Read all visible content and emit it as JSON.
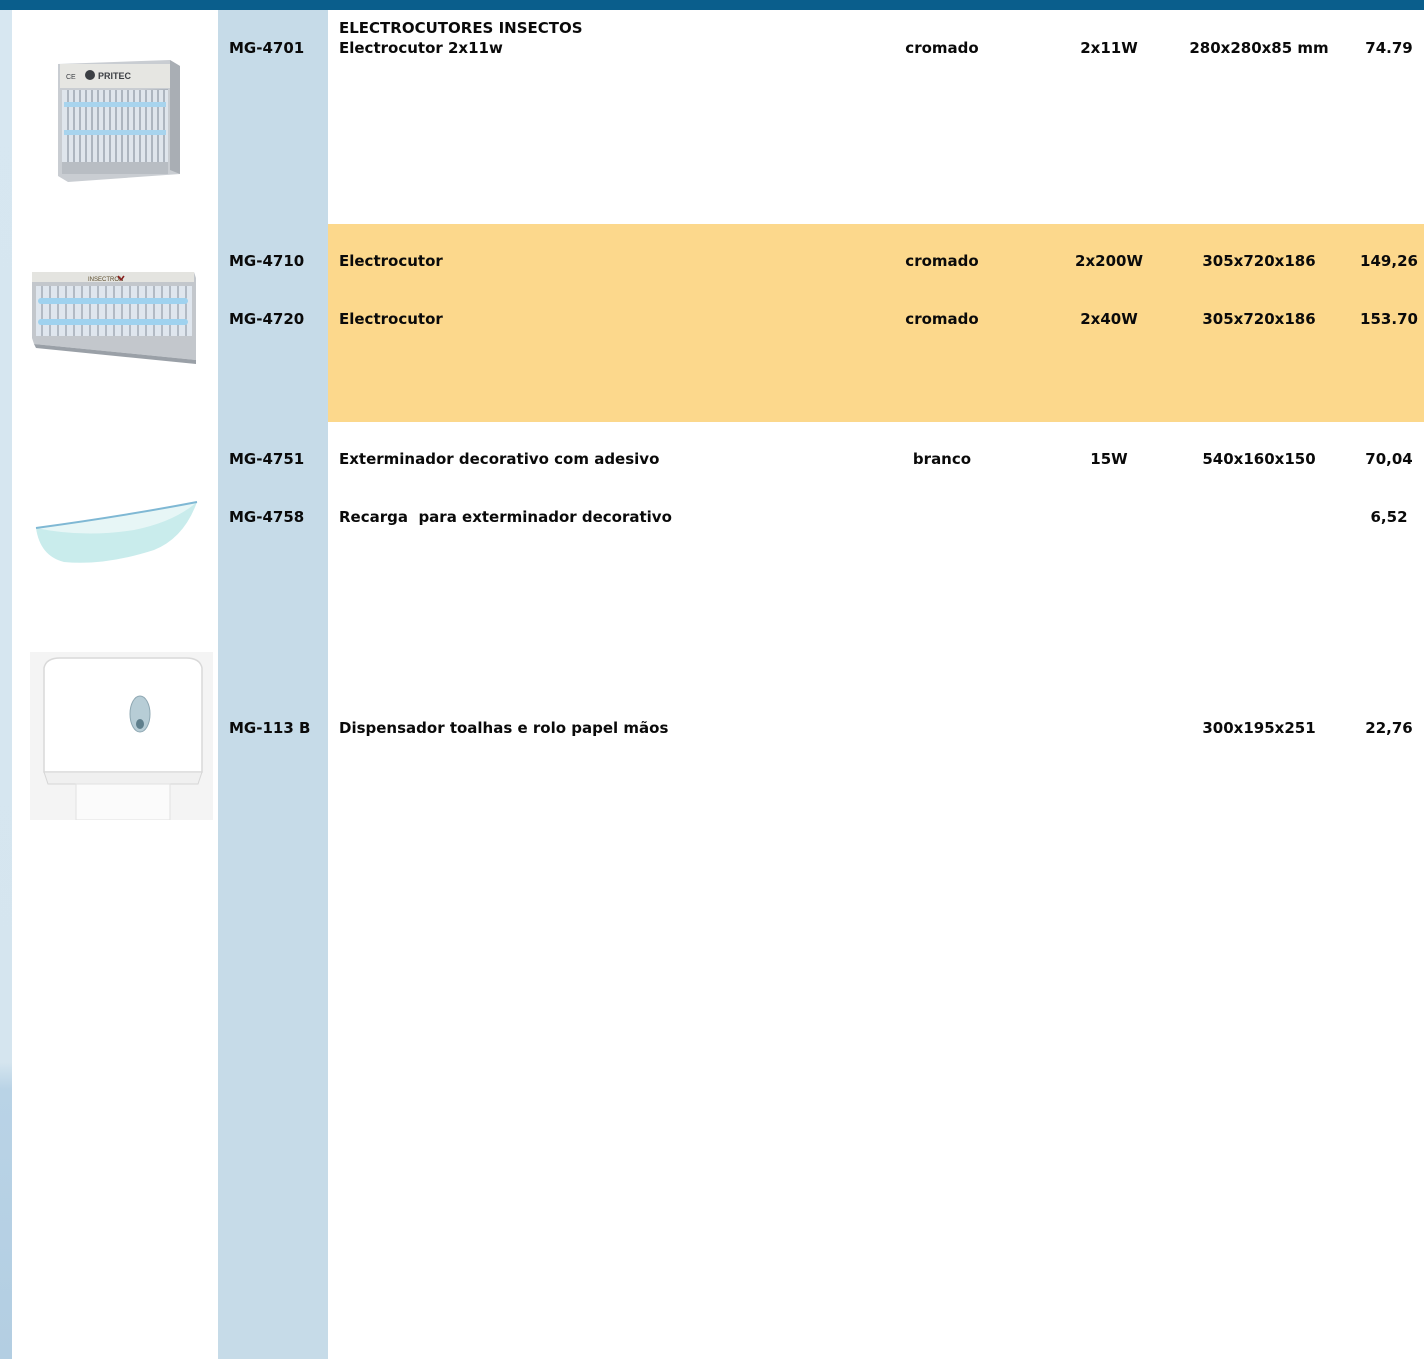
{
  "section_title": "ELECTROCUTORES INSECTOS",
  "rows": [
    {
      "code": "MG-4701",
      "description": "Electrocutor 2x11w",
      "finish": "cromado",
      "power": "2x11W",
      "dimensions": "280x280x85 mm",
      "price": "74.79"
    },
    {
      "code": "MG-4710",
      "description": "Electrocutor",
      "finish": "cromado",
      "power": "2x200W",
      "dimensions": "305x720x186",
      "price": "149,26"
    },
    {
      "code": "MG-4720",
      "description": "Electrocutor",
      "finish": "cromado",
      "power": "2x40W",
      "dimensions": "305x720x186",
      "price": "153.70"
    },
    {
      "code": "MG-4751",
      "description": "Exterminador decorativo com adesivo",
      "finish": "branco",
      "power": "15W",
      "dimensions": "540x160x150",
      "price": "70,04"
    },
    {
      "code": "MG-4758",
      "description": "Recarga  para exterminador decorativo",
      "finish": "",
      "power": "",
      "dimensions": "",
      "price": "6,52"
    },
    {
      "code": "MG-113 B",
      "description": "Dispensador toalhas e rolo papel mãos",
      "finish": "",
      "power": "",
      "dimensions": "300x195x251",
      "price": "22,76"
    }
  ],
  "images": {
    "square_zapper": {
      "icon": "square-insect-zapper",
      "brand_logo": "PRITEC"
    },
    "long_zapper": {
      "icon": "long-insect-zapper"
    },
    "decorative_trap": {
      "icon": "decorative-insect-trap"
    },
    "towel_dispenser": {
      "icon": "towel-dispenser"
    }
  },
  "colors": {
    "header_bar": "#0a5e8c",
    "code_column": "#c6dbe8",
    "highlight_row": "#fcd88c"
  }
}
